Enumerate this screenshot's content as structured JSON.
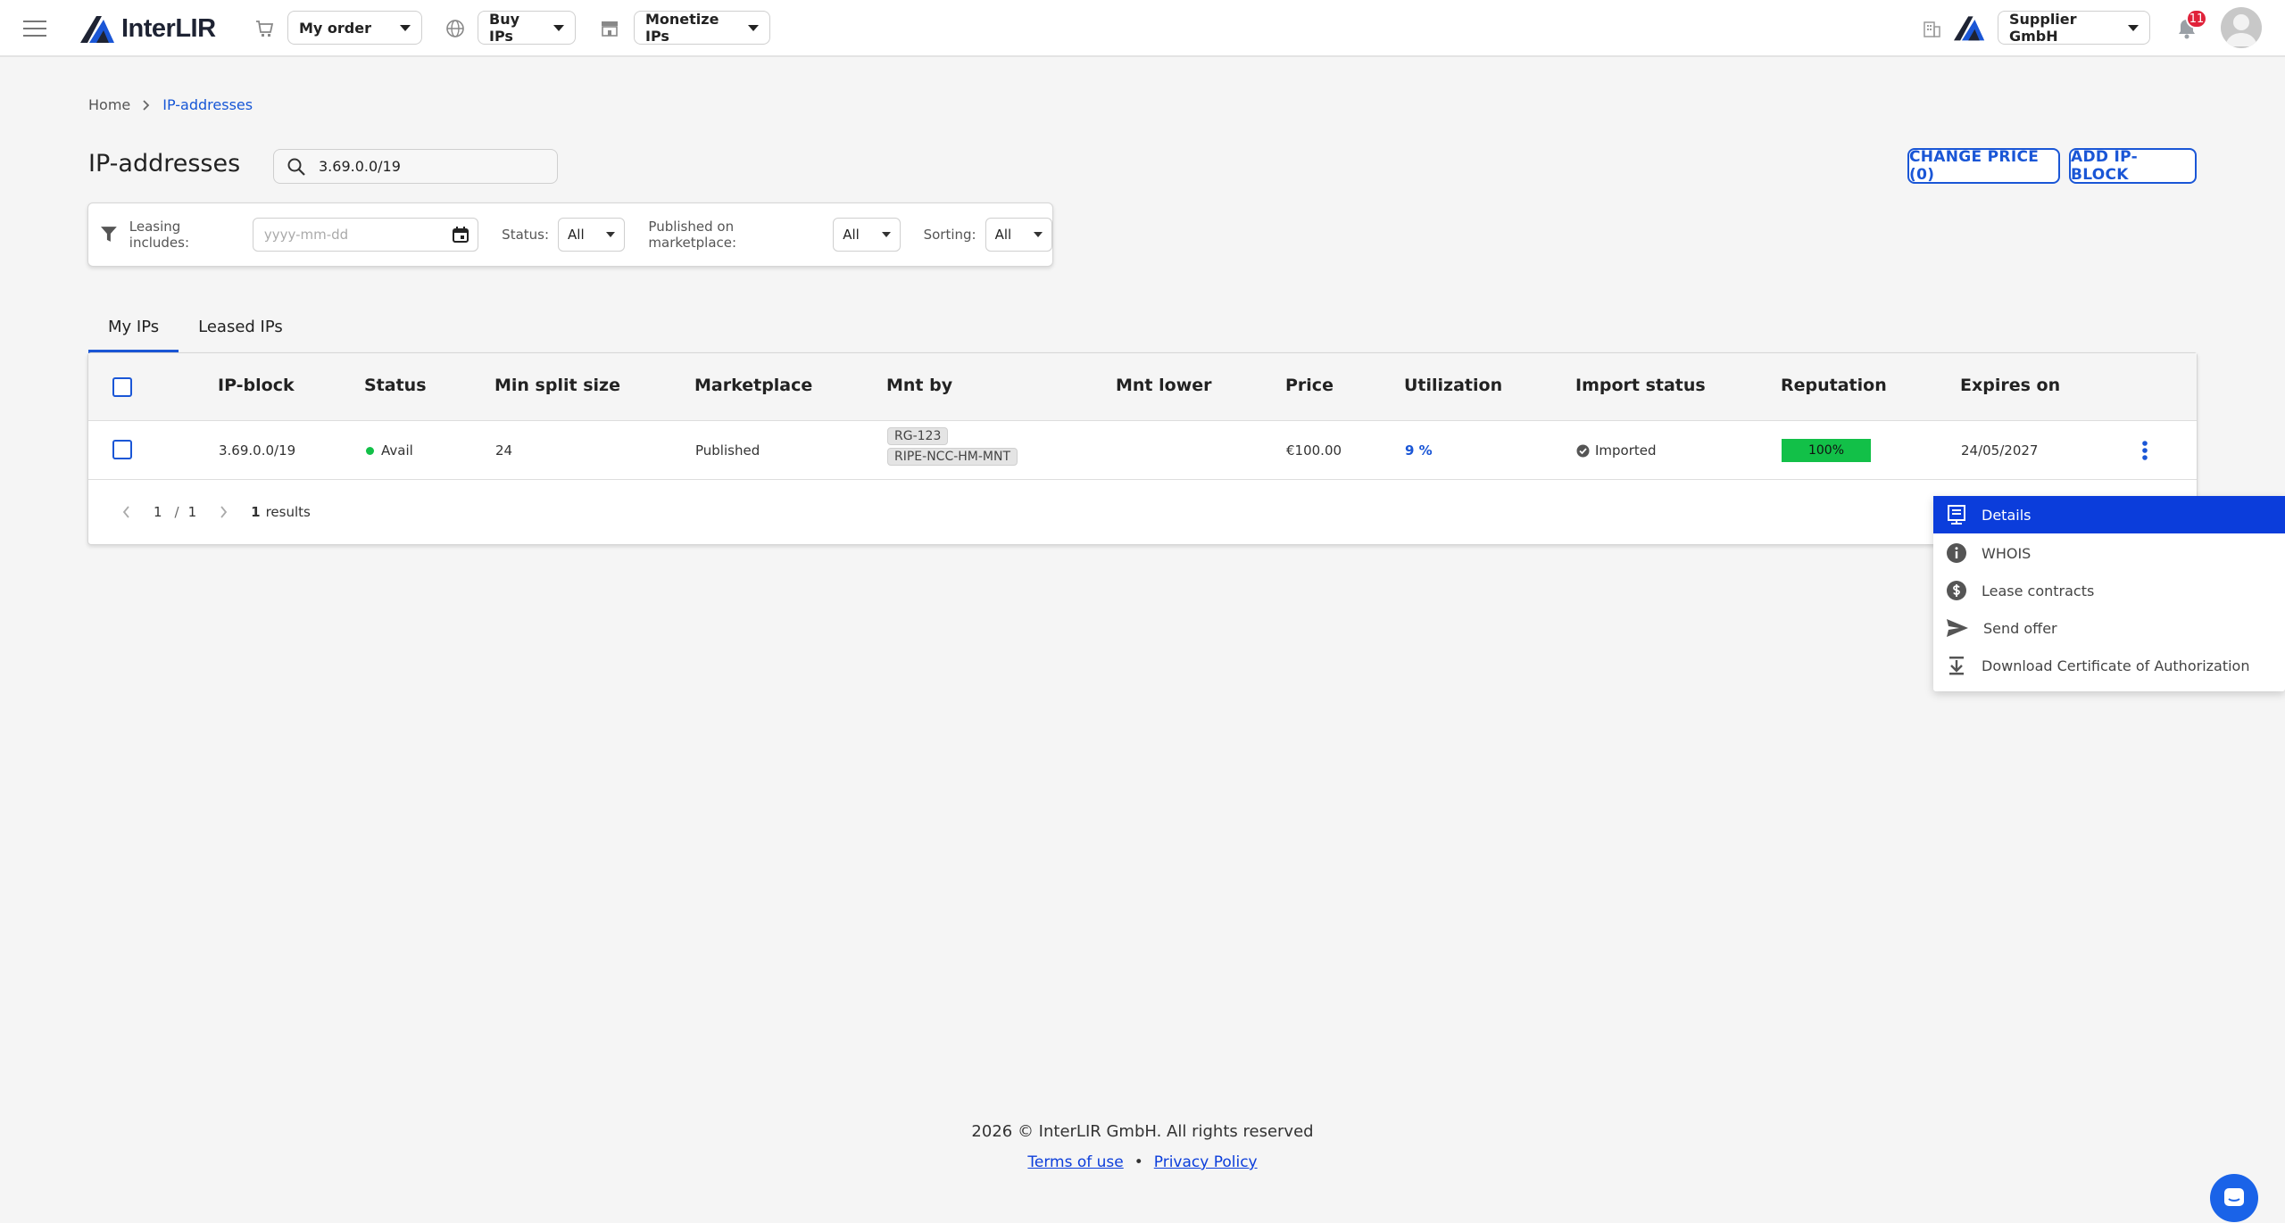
{
  "header": {
    "logo_text": "InterLIR",
    "my_order": "My order",
    "buy_ips": "Buy IPs",
    "monetize_ips": "Monetize IPs",
    "company": "Supplier GmbH",
    "notifications_count": "11"
  },
  "breadcrumb": {
    "home": "Home",
    "current": "IP-addresses"
  },
  "page": {
    "title": "IP-addresses",
    "search_value": "3.69.0.0/19",
    "change_price": "CHANGE PRICE (0)",
    "add_block": "ADD IP-BLOCK"
  },
  "filters": {
    "leasing_label": "Leasing includes:",
    "date_placeholder": "yyyy-mm-dd",
    "status_label": "Status:",
    "status_value": "All",
    "published_label": "Published on marketplace:",
    "published_value": "All",
    "sorting_label": "Sorting:",
    "sorting_value": "All"
  },
  "tabs": [
    {
      "label": "My IPs",
      "active": true
    },
    {
      "label": "Leased IPs",
      "active": false
    }
  ],
  "table": {
    "headers": [
      "IP-block",
      "Status",
      "Min split size",
      "Marketplace",
      "Mnt by",
      "Mnt lower",
      "Price",
      "Utilization",
      "Import status",
      "Reputation",
      "Expires on"
    ],
    "rows": [
      {
        "ip_block": "3.69.0.0/19",
        "status": "Avail",
        "min_split": "24",
        "marketplace": "Published",
        "mnt_by": [
          "RG-123",
          "RIPE-NCC-HM-MNT"
        ],
        "mnt_lower": "",
        "price": "€100.00",
        "utilization": "9 %",
        "import_status": "Imported",
        "reputation": "100%",
        "expires_on": "24/05/2027"
      }
    ]
  },
  "pagination": {
    "page": "1",
    "sep": "/",
    "total_pages": "1",
    "results_count": "1",
    "results_label": "results"
  },
  "context_menu": {
    "items": [
      {
        "label": "Details",
        "icon": "details-icon"
      },
      {
        "label": "WHOIS",
        "icon": "info-icon"
      },
      {
        "label": "Lease contracts",
        "icon": "dollar-icon"
      },
      {
        "label": "Send offer",
        "icon": "send-icon"
      },
      {
        "label": "Download Certificate of Authorization",
        "icon": "download-icon"
      }
    ]
  },
  "footer": {
    "copyright": "2026 © InterLIR GmbH. All rights reserved",
    "terms": "Terms of use",
    "privacy": "Privacy Policy",
    "bullet": "•"
  },
  "colors": {
    "accent": "#1a56d6",
    "active_menu": "#0b3ddb",
    "status_ok": "#12c048",
    "badge": "#e0223a"
  }
}
